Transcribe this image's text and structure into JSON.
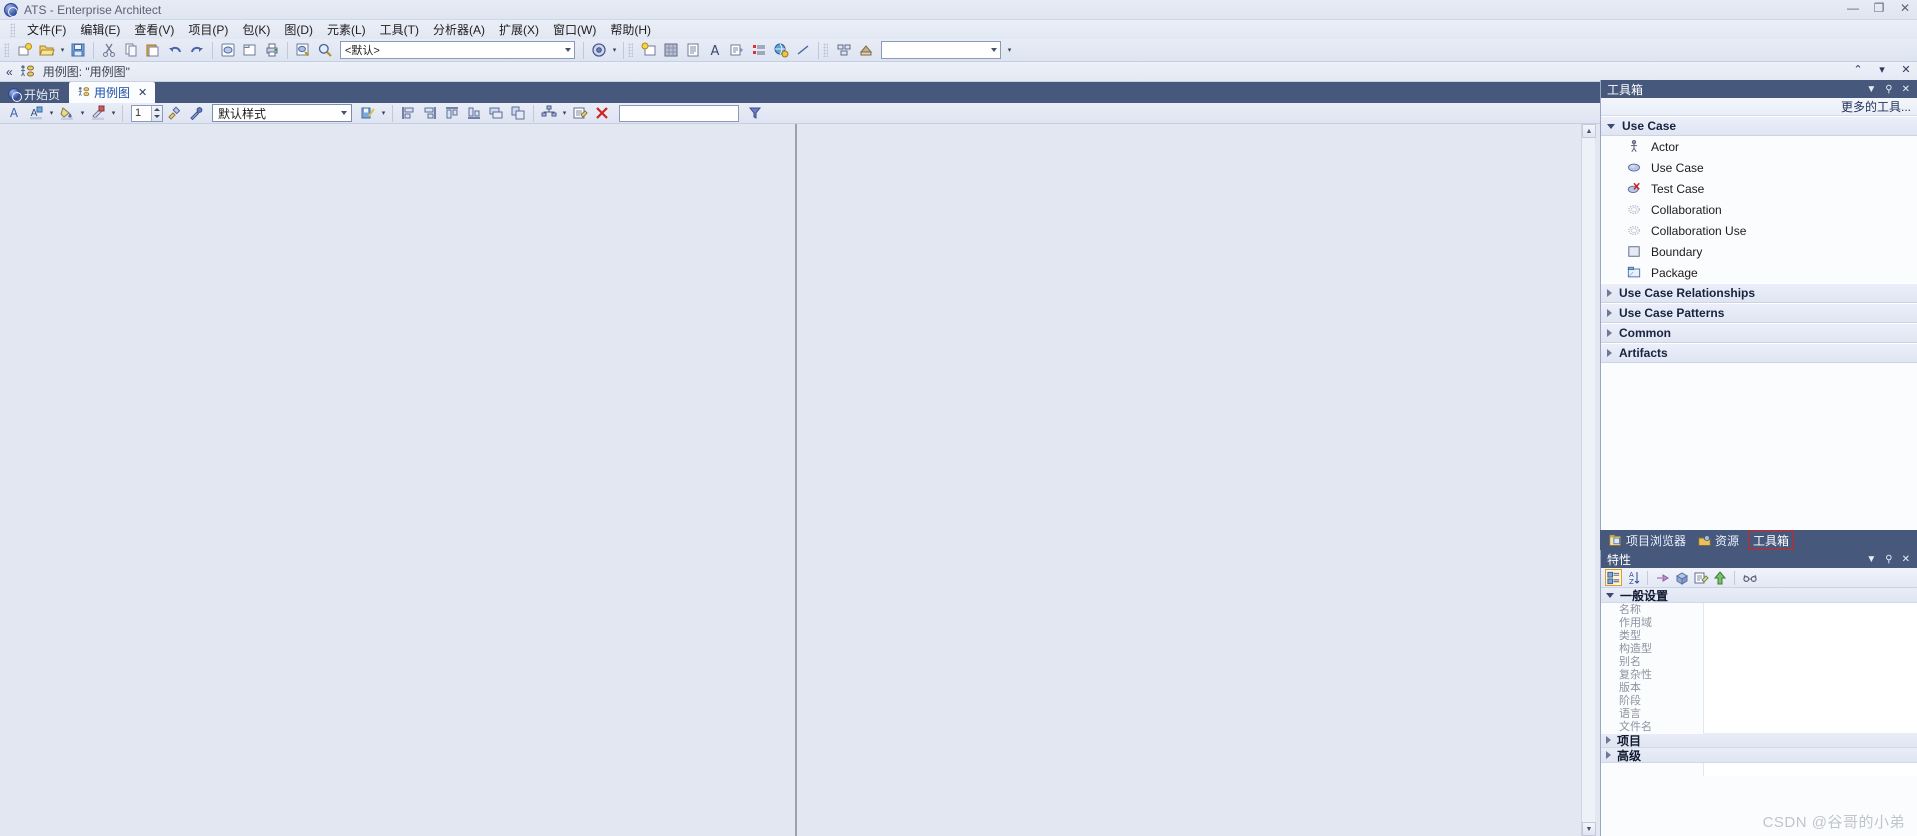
{
  "window": {
    "title": "ATS - Enterprise Architect",
    "app_icon": "ea-circle-icon",
    "minimize": "—",
    "maximize": "❐",
    "close": "✕"
  },
  "menubar": {
    "items": [
      {
        "label": "文件(F)",
        "name": "menu-file"
      },
      {
        "label": "编辑(E)",
        "name": "menu-edit"
      },
      {
        "label": "查看(V)",
        "name": "menu-view"
      },
      {
        "label": "项目(P)",
        "name": "menu-project"
      },
      {
        "label": "包(K)",
        "name": "menu-package"
      },
      {
        "label": "图(D)",
        "name": "menu-diagram"
      },
      {
        "label": "元素(L)",
        "name": "menu-element"
      },
      {
        "label": "工具(T)",
        "name": "menu-tools"
      },
      {
        "label": "分析器(A)",
        "name": "menu-analyzer"
      },
      {
        "label": "扩展(X)",
        "name": "menu-extensions"
      },
      {
        "label": "窗口(W)",
        "name": "menu-window"
      },
      {
        "label": "帮助(H)",
        "name": "menu-help"
      }
    ]
  },
  "toolbar": {
    "perspective_value": "<默认>",
    "quick_search_value": "",
    "buttons": [
      "new-project-icon",
      "open-folder-icon",
      "save-icon",
      "cut-icon",
      "copy-icon",
      "paste-icon",
      "undo-icon",
      "redo-icon",
      "new-diagram-icon",
      "new-package-icon",
      "print-icon",
      "print-preview-icon",
      "search-icon"
    ],
    "right_buttons": [
      "help-globe-icon",
      "new-element-icon",
      "matrix-icon",
      "document-icon",
      "font-icon",
      "report-icon",
      "list-icon",
      "web-icon",
      "line-icon",
      "layout-icon",
      "pattern-icon"
    ]
  },
  "breadcrumb": {
    "text": "用例图: \"用例图\"",
    "back_icon": "double-chevron-left-icon",
    "diagram_icon": "use-case-diagram-icon",
    "collapse_icon": "chevron-up-icon",
    "expand_icon": "chevron-down-icon",
    "close_icon": "close-icon"
  },
  "tabs": {
    "items": [
      {
        "label": "开始页",
        "icon": "ea-circle-icon",
        "active": false,
        "closable": false
      },
      {
        "label": "用例图",
        "icon": "use-case-diagram-icon",
        "active": true,
        "closable": true
      }
    ],
    "close_glyph": "✕",
    "nav_prev": "◁",
    "nav_next": "▷"
  },
  "format_toolbar": {
    "font_color_icon": "font-color-icon",
    "fill_color_icon": "fill-color-icon",
    "line_color_icon": "line-color-icon",
    "gradient_icon": "gradient-icon",
    "line_width_value": "1",
    "format_painter_icon": "format-painter-icon",
    "eyedropper_icon": "eyedropper-icon",
    "style_value": "默认样式",
    "save_style_icon": "save-style-icon",
    "align_left_icon": "align-left-icon",
    "align_right_icon": "align-right-icon",
    "align_top_icon": "align-top-icon",
    "align_bottom_icon": "align-bottom-icon",
    "same_width_icon": "same-width-icon",
    "same_height_icon": "same-height-icon",
    "auto_layout_icon": "auto-layout-icon",
    "note_icon": "note-icon",
    "delete_icon": "delete-red-x-icon",
    "filter_value": "",
    "filter_icon": "filter-funnel-icon"
  },
  "toolbox": {
    "title": "工具箱",
    "more_tools": "更多的工具...",
    "hide_icon": "chevron-down-icon",
    "pin_icon": "pin-icon",
    "close_icon": "close-icon",
    "groups": [
      {
        "label": "Use Case",
        "expanded": true,
        "items": [
          {
            "label": "Actor",
            "icon": "actor-stickman-icon"
          },
          {
            "label": "Use Case",
            "icon": "use-case-ellipse-icon"
          },
          {
            "label": "Test Case",
            "icon": "test-case-icon"
          },
          {
            "label": "Collaboration",
            "icon": "collaboration-icon"
          },
          {
            "label": "Collaboration Use",
            "icon": "collaboration-use-icon"
          },
          {
            "label": "Boundary",
            "icon": "boundary-icon"
          },
          {
            "label": "Package",
            "icon": "package-icon"
          }
        ]
      },
      {
        "label": "Use Case Relationships",
        "expanded": false,
        "items": []
      },
      {
        "label": "Use Case Patterns",
        "expanded": false,
        "items": []
      },
      {
        "label": "Common",
        "expanded": false,
        "items": []
      },
      {
        "label": "Artifacts",
        "expanded": false,
        "items": []
      }
    ]
  },
  "dock_tabs": {
    "items": [
      {
        "label": "项目浏览器",
        "icon": "project-browser-icon",
        "selected": false
      },
      {
        "label": "资源",
        "icon": "resources-icon",
        "selected": false
      },
      {
        "label": "工具箱",
        "icon": "toolbox-icon",
        "selected": true
      }
    ],
    "highlight_color": "#e02020"
  },
  "properties": {
    "title": "特性",
    "hide_icon": "chevron-down-icon",
    "pin_icon": "pin-icon",
    "close_icon": "close-icon",
    "toolbar_icons": [
      "categorized-icon",
      "sort-alpha-icon",
      "linked-element-icon",
      "element-icon",
      "edit-note-icon",
      "up-arrow-icon",
      "glasses-icon"
    ],
    "groups": [
      {
        "label": "一般设置",
        "expanded": true,
        "rows": [
          {
            "name": "名称",
            "value": ""
          },
          {
            "name": "作用域",
            "value": ""
          },
          {
            "name": "类型",
            "value": ""
          },
          {
            "name": "构造型",
            "value": ""
          },
          {
            "name": "别名",
            "value": ""
          },
          {
            "name": "复杂性",
            "value": ""
          },
          {
            "name": "版本",
            "value": ""
          },
          {
            "name": "阶段",
            "value": ""
          },
          {
            "name": "语言",
            "value": ""
          },
          {
            "name": "文件名",
            "value": ""
          }
        ]
      },
      {
        "label": "项目",
        "expanded": false,
        "rows": []
      },
      {
        "label": "高级",
        "expanded": false,
        "rows": []
      }
    ]
  },
  "watermark": "CSDN @谷哥的小弟",
  "colors": {
    "panel_header": "#46587c",
    "toolbar_bg": "#e4eaf4",
    "canvas_bg": "#e2e7f2",
    "accent_red": "#e02020"
  }
}
